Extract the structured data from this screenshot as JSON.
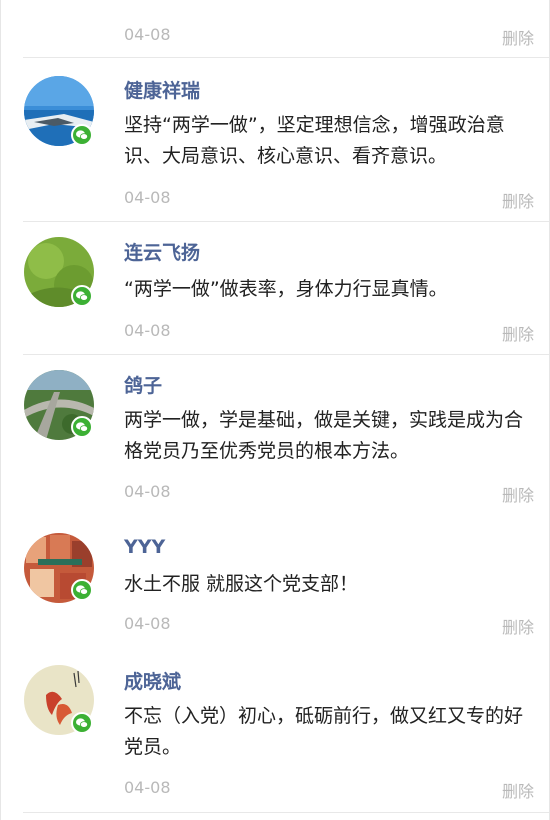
{
  "top_entry": {
    "date": "04-08",
    "delete_label": "删除"
  },
  "comments": [
    {
      "name": "健康祥瑞",
      "text": "坚持“两学一做”，坚定理想信念，增强政治意识、大局意识、核心意识、看齐意识。",
      "date": "04-08",
      "delete_label": "删除",
      "avatar_icon": "seascape-avatar"
    },
    {
      "name": "连云飞扬",
      "text": "“两学一做”做表率，身体力行显真情。",
      "date": "04-08",
      "delete_label": "删除",
      "avatar_icon": "green-grass-avatar"
    },
    {
      "name": "鸽子",
      "text": "两学一做，学是基础，做是关键，实践是成为合格党员乃至优秀党员的根本方法。",
      "date": "04-08",
      "delete_label": "删除",
      "avatar_icon": "highway-aerial-avatar"
    },
    {
      "name": "YYY",
      "text": "水土不服 就服这个党支部！",
      "date": "04-08",
      "delete_label": "删除",
      "avatar_icon": "photo-collage-avatar"
    },
    {
      "name": "成晓斌",
      "text": "不忘（入党）初心，砥砺前行，做又红又专的好党员。",
      "date": "04-08",
      "delete_label": "删除",
      "avatar_icon": "koi-painting-avatar"
    }
  ],
  "colors": {
    "name": "#4d6496",
    "meta": "#b9b9b9",
    "text": "#222222",
    "wechat_badge": "#3cb034"
  }
}
